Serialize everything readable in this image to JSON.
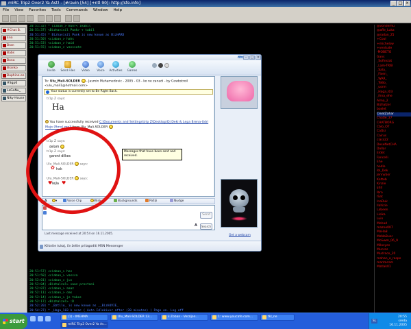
{
  "mirc": {
    "title": "mIRC Trip2 Over2 Ya Ast! - [#ravin [54] [+ntl 90]: http://sfe.info]",
    "menu": [
      "File",
      "View",
      "Favorites",
      "Tools",
      "Commands",
      "Window",
      "Help"
    ],
    "switchbar": [
      "#Chat B.",
      "Ena",
      "Bran",
      "Babs",
      "Bona",
      "Branko",
      "Buphine.ee",
      "#Sgp6",
      "LaGaNu_",
      "Niky-House"
    ],
    "log_top": [
      "20:51:32] * ciaban_> Bunr< ikabil",
      "20:51:37] <Bizhavisil Punk> + tabil",
      "20:51:45] * Bizhavisil Punk is now known as BizHARD",
      "20:51:50] <ciaban_> hahs",
      "20:51:53] <ciaban_> haid",
      "20:51:55] <ciaban_> vasssate"
    ],
    "log_bottom": [
      "20:51:57] <ciaban_> hes",
      "20:51:58] <ciaban_> vasssa",
      "20:52:01] <ciaban_> jus",
      "20:52:04] <Bizhalzel> vaaz prestani",
      "20:52:07] <ciaban_> aaaz",
      "20:52:11] <ciaban_> oms",
      "20:52:14] <ciaban_> je takes",
      "20:52:17] <Bizhalzel> :D",
      "20:52:20] * _Bztllo_ is now known as __BizH4VIE_",
      "20:54:27] * _Haga_l03 k asac ( Auto Idlekiver after (20 minutes) ) Page on. Log off",
      "20:54:52] * ZHftp has joined #ravin"
    ],
    "nicklist": [
      "@vonderflu",
      "@afle_Luka",
      "@radan_25",
      "+Cool",
      "+michelsw",
      "+ventude",
      "-MOBETO",
      "Gans",
      "_Sofinstat",
      "_Lam-TRIB",
      "_Sala_",
      "_Fixen_",
      "_WAR_",
      "_TeBo_",
      "_uorm",
      "_Haga_l03",
      "_ihna_ehe",
      "Alma_2",
      "Bizhalzel",
      "boxlet",
      "CleatZahar",
      "Chatle_37",
      "CHATBORG",
      "Cblo_OT",
      "Cattsi",
      "Cairus",
      "ciara22",
      "DeseNetCHA",
      "Dollar",
      "Eldet",
      "Fancelli",
      "Ehe",
      "hodle",
      "ibl_Dek",
      "Jennybor",
      "Katteb",
      "Kinzie",
      "ijitd",
      "Ibra",
      "ISat",
      "InaDuk",
      "Ilahizie",
      "Labeen",
      "Lisika",
      "Luin",
      "Mohad",
      "mazne007",
      "MaHa8",
      "MaNaBuer",
      "Mc&wm_06_9",
      "Milosyes",
      "Munros",
      "Mudrace_20",
      "mahan_o_raspe",
      "mantacam",
      "Matlak01"
    ],
    "nick_selected_index": 20,
    "taskbar": {
      "start": "start",
      "tasks": [
        "(1) - IMEHMA",
        "Ulu_Mali-SOLDER 13...",
        "ii Zoban - Verzijon...",
        "1: www.youcafe.com...",
        "tkl_ne",
        "mIRC Trip2 Over2 Ya As..."
      ],
      "lang": "SL",
      "time": "20:55",
      "day": "sreda",
      "date": "16.11.2005"
    }
  },
  "msn": {
    "logo": "msn",
    "toolbar": [
      "Invite",
      "Send Files",
      "Video",
      "Voice",
      "Activities",
      "Games"
    ],
    "to_prefix": "To:",
    "to_name": "Ulu_Mali-SOLDER",
    "to_rest": "- Jasmin Muhamedovic - 2005 - 03 - ko ne zanadi - by Cewbstroil <ulu_mali1@hotmail.com>",
    "status_notice": "Your status is currently set to Be Right Back.",
    "messages": [
      {
        "sender": "tr1p Z",
        "says": "says:",
        "text": "Ha"
      },
      {
        "transfer_prefix": "You have successfully received",
        "file_path": "C:\\Documents and Settings\\trip Z\\Desktop\\Dj Deki & Lepa Brena-Udri Mujo (Rmx).mp3",
        "from_text": "from Ulu_Mali-SOLDER"
      },
      {
        "sender": "tr1p Z",
        "says": "says:",
        "text": "selam"
      },
      {
        "sender": "tr1p Z",
        "says": "says:",
        "text": "garent dilkes"
      },
      {
        "sender": "Ulu_Mali-SOLDER",
        "says": "says:",
        "text": "hak"
      },
      {
        "sender": "Ulu_Mali-SOLDER",
        "says": "says:",
        "text": "lejla"
      }
    ],
    "tooltip": "Messages that have been sent and received.",
    "format_bar": [
      "A",
      "Voice Clip",
      "Wink",
      "Backgrounds",
      "Pošlji",
      "Nudge"
    ],
    "send_label": "Send",
    "search_label": "Search",
    "font_label": "A",
    "last_message": "Last message received at 20:54 on 16.11.2005.",
    "webcam_link": "Get a webcam",
    "ad_text": "Kliknite tukaj, če želite prilagoditi MSN Messenger"
  },
  "colors": {
    "log_green": "#22c55e",
    "nick_red": "#e11",
    "annotation": "#e01212",
    "taskbar": "#245edb"
  }
}
